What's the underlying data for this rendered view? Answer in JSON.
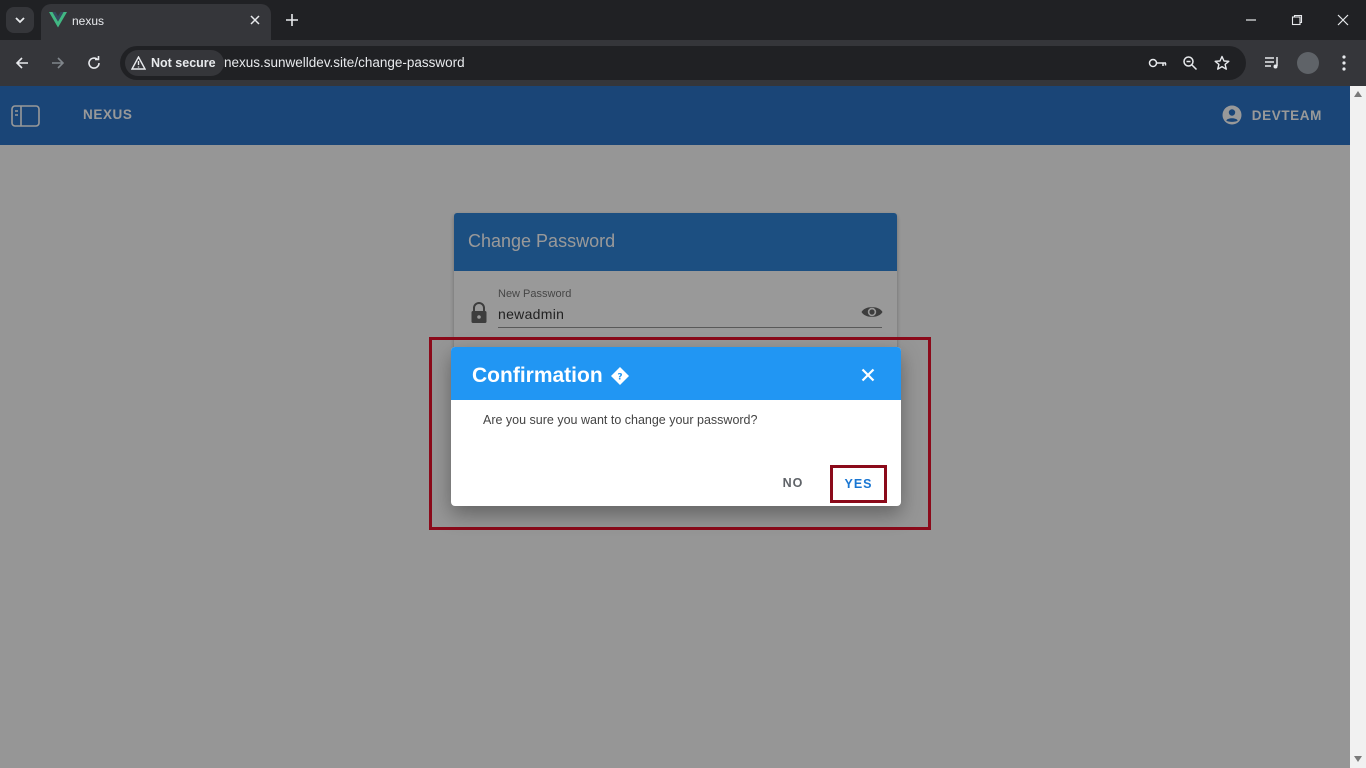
{
  "browser": {
    "tab_title": "nexus",
    "security_label": "Not secure",
    "url": "nexus.sunwelldev.site/change-password"
  },
  "app": {
    "title": "NEXUS",
    "user_name": "DEVTEAM"
  },
  "change_password_card": {
    "title": "Change Password",
    "field_label": "New Password",
    "field_value": "newadmin"
  },
  "dialog": {
    "title": "Confirmation",
    "message": "Are you sure you want to change your password?",
    "no_label": "NO",
    "yes_label": "YES"
  },
  "colors": {
    "appbar": "#1565c0",
    "card_header": "#1976d2",
    "dialog_header": "#2196f3",
    "highlight": "#8b0a1a"
  },
  "icons": [
    "tab-list-icon",
    "vue-logo-icon",
    "close-icon",
    "plus-icon",
    "minimize-icon",
    "restore-icon",
    "back-icon",
    "forward-icon",
    "reload-icon",
    "warning-icon",
    "key-icon",
    "zoom-icon",
    "star-icon",
    "media-icon",
    "profile-avatar",
    "menu-dots-icon",
    "sidebar-toggle-icon",
    "account-circle-icon",
    "lock-icon",
    "eye-icon",
    "help-diamond-icon"
  ]
}
